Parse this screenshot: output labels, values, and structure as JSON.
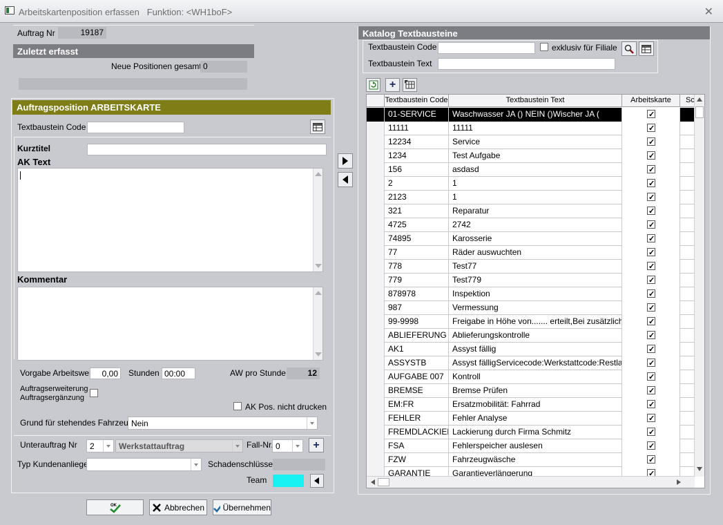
{
  "window": {
    "title": "Arbeitskartenposition erfassen   Funktion: <WH1boF>"
  },
  "top": {
    "auftrag_label": "Auftrag Nr",
    "auftrag_value": "19187",
    "zuletzt_title": "Zuletzt erfasst",
    "neue_label": "Neue Positionen gesamt",
    "neue_value": "0"
  },
  "position": {
    "title": "Auftragsposition  ARBEITSKARTE",
    "code_label": "Textbaustein Code",
    "kurztitel_label": "Kurztitel",
    "aktext_label": "AK Text",
    "kommentar_label": "Kommentar",
    "vorgabe_label": "Vorgabe Arbeitswert",
    "vorgabe_value": "0,00",
    "stunden_label": "Stunden",
    "stunden_value": "00:00",
    "awpro_label": "AW pro Stunde",
    "awpro_value": "12",
    "erweiterung_label1": "Auftragserweiterung",
    "erweiterung_label2": "Auftragsergänzung",
    "nicht_drucken_label": "AK Pos. nicht drucken",
    "grund_label": "Grund für stehendes Fahrzeug",
    "grund_value": "Nein",
    "unterauftrag_label": "Unterauftrag Nr",
    "unterauftrag_value": "2",
    "werkstatt_value": "Werkstattauftrag",
    "fallnr_label": "Fall-Nr.",
    "fallnr_value": "0",
    "typ_label": "Typ Kundenanliegen",
    "schaden_label": "Schadenschlüssel",
    "team_label": "Team",
    "team_color": "#19f2f2"
  },
  "catalog": {
    "title": "Katalog Textbausteine",
    "code_label": "Textbaustein Code",
    "exklusiv_label": "exklusiv für Filiale",
    "text_label": "Textbaustein Text",
    "columns": [
      "Textbaustein Code",
      "Textbaustein Text",
      "Arbeitskarte",
      "Sc"
    ],
    "rows": [
      {
        "code": "01-SERVICE",
        "text": "Waschwasser  JA  ()  NEIN  ()Wischer        JA  (",
        "selected": true
      },
      {
        "code": "11111",
        "text": "11111"
      },
      {
        "code": "12234",
        "text": "Service"
      },
      {
        "code": "1234",
        "text": "Test Aufgabe"
      },
      {
        "code": "156",
        "text": "asdasd"
      },
      {
        "code": "2",
        "text": "1"
      },
      {
        "code": "2123",
        "text": "1"
      },
      {
        "code": "321",
        "text": "Reparatur"
      },
      {
        "code": "4725",
        "text": "2742"
      },
      {
        "code": "74895",
        "text": "Karosserie"
      },
      {
        "code": "77",
        "text": "Räder auswuchten"
      },
      {
        "code": "778",
        "text": "Test77"
      },
      {
        "code": "779",
        "text": "Test779"
      },
      {
        "code": "878978",
        "text": "Inspektion"
      },
      {
        "code": "987",
        "text": "Vermessung"
      },
      {
        "code": "99-9998",
        "text": "Freigabe in Höhe von....... erteilt,Bei zusätzlichen"
      },
      {
        "code": "ABLIEFERUNG",
        "text": "Ablieferungskontrolle"
      },
      {
        "code": "AK1",
        "text": "Assyst fällig"
      },
      {
        "code": "ASSYSTB",
        "text": "Assyst fälligServicecode:Werkstattcode:Restlaufta"
      },
      {
        "code": "AUFGABE 007",
        "text": "Kontroll"
      },
      {
        "code": "BREMSE",
        "text": "Bremse Prüfen"
      },
      {
        "code": "EM:FR",
        "text": "Ersatzmobilität: Fahrrad"
      },
      {
        "code": "FEHLER",
        "text": "Fehler Analyse"
      },
      {
        "code": "FREMDLACKIER",
        "text": "Lackierung durch Firma Schmitz"
      },
      {
        "code": "FSA",
        "text": "Fehlerspeicher auslesen"
      },
      {
        "code": "FZW",
        "text": "Fahrzeugwäsche"
      },
      {
        "code": "GARANTIE",
        "text": "Garantieverlängerung"
      }
    ]
  },
  "buttons": {
    "ok": "OK",
    "cancel": "Abbrechen",
    "apply": "Übernehmen"
  }
}
